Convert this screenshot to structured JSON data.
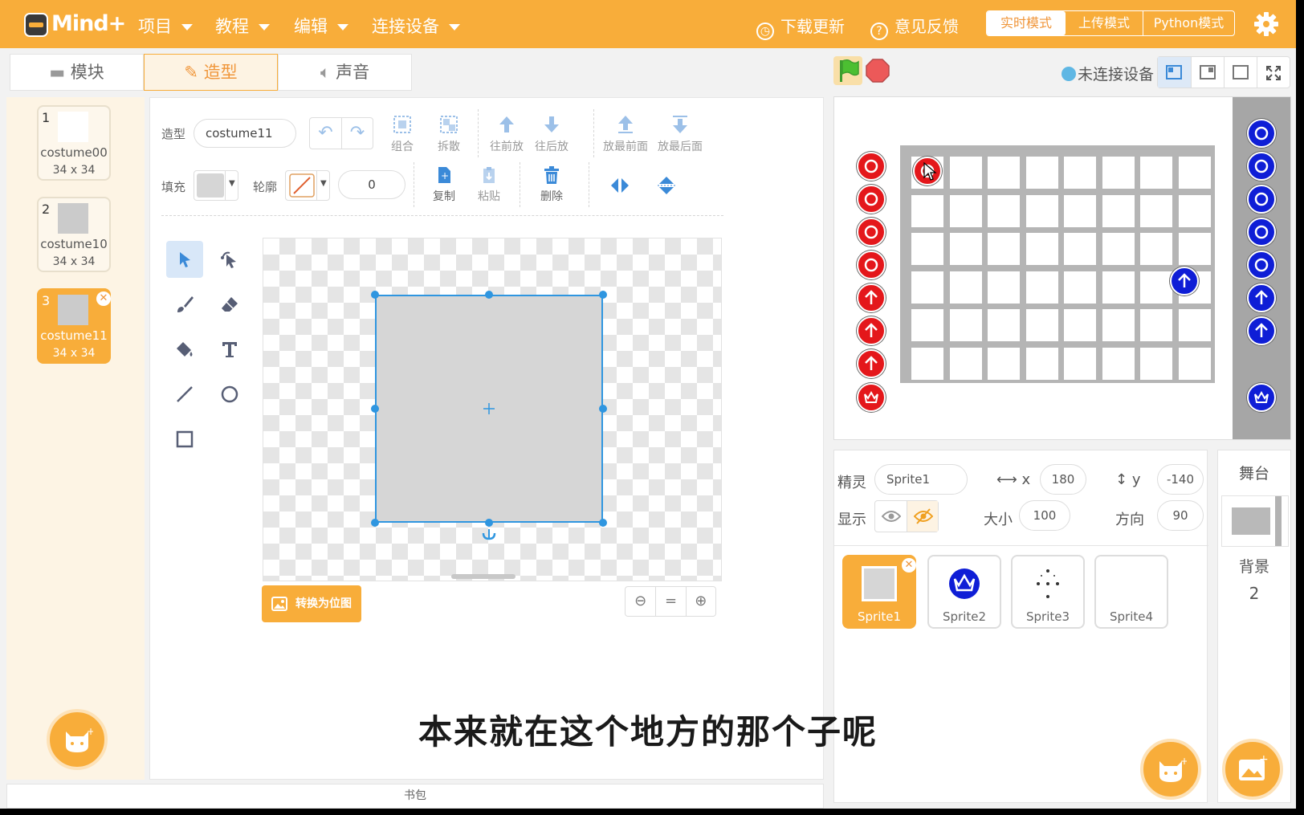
{
  "app": {
    "brand": "Mind+",
    "menus": [
      "项目",
      "教程",
      "编辑",
      "连接设备"
    ],
    "download_update": "下载更新",
    "feedback": "意见反馈",
    "modes": [
      "实时模式",
      "上传模式",
      "Python模式"
    ],
    "active_mode": "实时模式"
  },
  "tabs": [
    "模块",
    "造型",
    "声音"
  ],
  "costumes": [
    {
      "index": "1",
      "name": "costume00",
      "size": "34 x 34"
    },
    {
      "index": "2",
      "name": "costume10",
      "size": "34 x 34"
    },
    {
      "index": "3",
      "name": "costume11",
      "size": "34 x 34"
    }
  ],
  "editor": {
    "costume_label": "造型",
    "costume_name": "costume11",
    "group": "组合",
    "ungroup": "拆散",
    "forward": "往前放",
    "backward": "往后放",
    "front": "放最前面",
    "back": "放最后面",
    "fill_label": "填充",
    "outline_label": "轮廓",
    "outline_width": "0",
    "copy": "复制",
    "paste": "粘贴",
    "delete": "删除",
    "convert_bitmap": "转换为位图",
    "fill_color": "#d6d6d6",
    "outline_color": "none"
  },
  "backpack": "书包",
  "stage": {
    "connection": "未连接设备",
    "accent_red": "#e4171b",
    "accent_blue": "#0f1ed6"
  },
  "sprite": {
    "label_sprite": "精灵",
    "name": "Sprite1",
    "label_x": "x",
    "x": "180",
    "label_y": "y",
    "y": "-140",
    "label_show": "显示",
    "label_size": "大小",
    "size": "100",
    "label_direction": "方向",
    "direction": "90",
    "sprites": [
      "Sprite1",
      "Sprite2",
      "Sprite3",
      "Sprite4"
    ]
  },
  "stage_side": {
    "title": "舞台",
    "backdrop_label": "背景",
    "backdrop_count": "2"
  },
  "subtitle": "本来就在这个地方的那个子呢"
}
